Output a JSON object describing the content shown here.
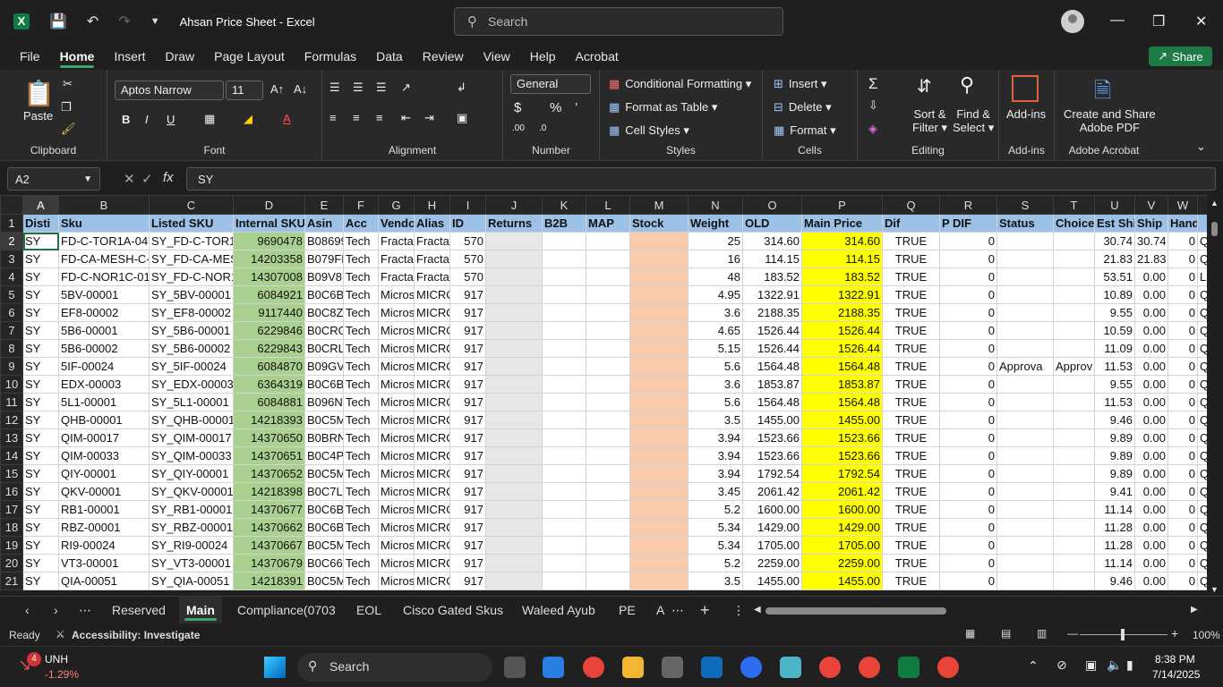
{
  "window": {
    "app_icon": "excel-icon",
    "title": "Ahsan Price Sheet  -  Excel",
    "search_placeholder": "Search"
  },
  "menu": [
    "File",
    "Home",
    "Insert",
    "Draw",
    "Page Layout",
    "Formulas",
    "Data",
    "Review",
    "View",
    "Help",
    "Acrobat"
  ],
  "share_label": "Share",
  "ribbon": {
    "paste": "Paste",
    "clipboard": "Clipboard",
    "font_name": "Aptos Narrow",
    "font_size": "11",
    "font": "Font",
    "alignment": "Alignment",
    "number_format": "General",
    "number": "Number",
    "conditional_formatting": "Conditional Formatting",
    "format_as_table": "Format as Table",
    "cell_styles": "Cell Styles",
    "styles": "Styles",
    "insert": "Insert",
    "delete": "Delete",
    "format": "Format",
    "cells": "Cells",
    "sort_filter_1": "Sort &",
    "sort_filter_2": "Filter",
    "find_select_1": "Find &",
    "find_select_2": "Select",
    "editing": "Editing",
    "addins": "Add-ins",
    "addins_group": "Add-ins",
    "create_share_1": "Create and Share",
    "create_share_2": "Adobe PDF",
    "adobe_acrobat": "Adobe Acrobat"
  },
  "formula_bar": {
    "name_box": "A2",
    "content": "SY"
  },
  "columns": [
    "A",
    "B",
    "C",
    "D",
    "E",
    "F",
    "G",
    "H",
    "I",
    "J",
    "K",
    "L",
    "M",
    "N",
    "O",
    "P",
    "Q",
    "R",
    "S",
    "T",
    "U",
    "V",
    "W",
    "X"
  ],
  "header_row": [
    "Disti",
    "Sku",
    "Listed SKU",
    "Internal SKU",
    "Asin",
    "Acc",
    "Vendor",
    "Alias",
    "ID",
    "Returns",
    "B2B",
    "MAP",
    "Stock",
    "Weight",
    "OLD",
    "Main Price",
    "Dif",
    "P DIF",
    "Status",
    "Choice",
    "Est Ship",
    "Ship",
    "Hand",
    ""
  ],
  "rows": [
    [
      "SY",
      "FD-C-TOR1A-04",
      "SY_FD-C-TOR1A",
      "9690478",
      "B08699",
      "Tech",
      "Fracta",
      "Fracta",
      "570",
      "",
      "",
      "",
      "",
      "25",
      "314.60",
      "314.60",
      "TRUE",
      "0",
      "",
      "",
      "30.74",
      "30.74",
      "0",
      "Q"
    ],
    [
      "SY",
      "FD-CA-MESH-C-E",
      "SY_FD-CA-MESH",
      "14203358",
      "B079FF",
      "Tech",
      "Fracta",
      "Fracta",
      "570",
      "",
      "",
      "",
      "",
      "16",
      "114.15",
      "114.15",
      "TRUE",
      "0",
      "",
      "",
      "21.83",
      "21.83",
      "0",
      "Q"
    ],
    [
      "SY",
      "FD-C-NOR1C-01",
      "SY_FD-C-NOR1C",
      "14307008",
      "B09V87",
      "Tech",
      "Fracta",
      "Fracta",
      "570",
      "",
      "",
      "",
      "",
      "48",
      "183.52",
      "183.52",
      "TRUE",
      "0",
      "",
      "",
      "53.51",
      "0.00",
      "0",
      "L"
    ],
    [
      "SY",
      "5BV-00001",
      "SY_5BV-00001",
      "6084921",
      "B0C6BI",
      "Tech",
      "Micros",
      "MICRO",
      "917",
      "",
      "",
      "",
      "",
      "4.95",
      "1322.91",
      "1322.91",
      "TRUE",
      "0",
      "",
      "",
      "10.89",
      "0.00",
      "0",
      "Q"
    ],
    [
      "SY",
      "EF8-00002",
      "SY_EF8-00002",
      "9117440",
      "B0C8ZC",
      "Tech",
      "Micros",
      "MICRO",
      "917",
      "",
      "",
      "",
      "",
      "3.6",
      "2188.35",
      "2188.35",
      "TRUE",
      "0",
      "",
      "",
      "9.55",
      "0.00",
      "0",
      "Q"
    ],
    [
      "SY",
      "5B6-00001",
      "SY_5B6-00001",
      "6229846",
      "B0CRG",
      "Tech",
      "Micros",
      "MICRO",
      "917",
      "",
      "",
      "",
      "",
      "4.65",
      "1526.44",
      "1526.44",
      "TRUE",
      "0",
      "",
      "",
      "10.59",
      "0.00",
      "0",
      "Q"
    ],
    [
      "SY",
      "5B6-00002",
      "SY_5B6-00002",
      "6229843",
      "B0CRLS",
      "Tech",
      "Micros",
      "MICRO",
      "917",
      "",
      "",
      "",
      "",
      "5.15",
      "1526.44",
      "1526.44",
      "TRUE",
      "0",
      "",
      "",
      "11.09",
      "0.00",
      "0",
      "Q"
    ],
    [
      "SY",
      "5IF-00024",
      "SY_5IF-00024",
      "6084870",
      "B09GVS",
      "Tech",
      "Micros",
      "MICRO",
      "917",
      "",
      "",
      "",
      "",
      "5.6",
      "1564.48",
      "1564.48",
      "TRUE",
      "0",
      "Approva",
      "Approv",
      "11.53",
      "0.00",
      "0",
      "Q"
    ],
    [
      "SY",
      "EDX-00003",
      "SY_EDX-00003",
      "6364319",
      "B0C6BI",
      "Tech",
      "Micros",
      "MICRO",
      "917",
      "",
      "",
      "",
      "",
      "3.6",
      "1853.87",
      "1853.87",
      "TRUE",
      "0",
      "",
      "",
      "9.55",
      "0.00",
      "0",
      "Q"
    ],
    [
      "SY",
      "5L1-00001",
      "SY_5L1-00001",
      "6084881",
      "B096N",
      "Tech",
      "Micros",
      "MICRO",
      "917",
      "",
      "",
      "",
      "",
      "5.6",
      "1564.48",
      "1564.48",
      "TRUE",
      "0",
      "",
      "",
      "11.53",
      "0.00",
      "0",
      "Q"
    ],
    [
      "SY",
      "QHB-00001",
      "SY_QHB-00001",
      "14218393",
      "B0C5M",
      "Tech",
      "Micros",
      "MICRO",
      "917",
      "",
      "",
      "",
      "",
      "3.5",
      "1455.00",
      "1455.00",
      "TRUE",
      "0",
      "",
      "",
      "9.46",
      "0.00",
      "0",
      "Q"
    ],
    [
      "SY",
      "QIM-00017",
      "SY_QIM-00017",
      "14370650",
      "B0BRN",
      "Tech",
      "Micros",
      "MICRO",
      "917",
      "",
      "",
      "",
      "",
      "3.94",
      "1523.66",
      "1523.66",
      "TRUE",
      "0",
      "",
      "",
      "9.89",
      "0.00",
      "0",
      "Q"
    ],
    [
      "SY",
      "QIM-00033",
      "SY_QIM-00033",
      "14370651",
      "B0C4PY",
      "Tech",
      "Micros",
      "MICRO",
      "917",
      "",
      "",
      "",
      "",
      "3.94",
      "1523.66",
      "1523.66",
      "TRUE",
      "0",
      "",
      "",
      "9.89",
      "0.00",
      "0",
      "Q"
    ],
    [
      "SY",
      "QIY-00001",
      "SY_QIY-00001",
      "14370652",
      "B0C5M",
      "Tech",
      "Micros",
      "MICRO",
      "917",
      "",
      "",
      "",
      "",
      "3.94",
      "1792.54",
      "1792.54",
      "TRUE",
      "0",
      "",
      "",
      "9.89",
      "0.00",
      "0",
      "Q"
    ],
    [
      "SY",
      "QKV-00001",
      "SY_QKV-00001",
      "14218398",
      "B0C7LH",
      "Tech",
      "Micros",
      "MICRO",
      "917",
      "",
      "",
      "",
      "",
      "3.45",
      "2061.42",
      "2061.42",
      "TRUE",
      "0",
      "",
      "",
      "9.41",
      "0.00",
      "0",
      "Q"
    ],
    [
      "SY",
      "RB1-00001",
      "SY_RB1-00001",
      "14370677",
      "B0C6B",
      "Tech",
      "Micros",
      "MICRO",
      "917",
      "",
      "",
      "",
      "",
      "5.2",
      "1600.00",
      "1600.00",
      "TRUE",
      "0",
      "",
      "",
      "11.14",
      "0.00",
      "0",
      "Q"
    ],
    [
      "SY",
      "RBZ-00001",
      "SY_RBZ-00001",
      "14370662",
      "B0C6B3",
      "Tech",
      "Micros",
      "MICRO",
      "917",
      "",
      "",
      "",
      "",
      "5.34",
      "1429.00",
      "1429.00",
      "TRUE",
      "0",
      "",
      "",
      "11.28",
      "0.00",
      "0",
      "Q"
    ],
    [
      "SY",
      "RI9-00024",
      "SY_RI9-00024",
      "14370667",
      "B0C5M",
      "Tech",
      "Micros",
      "MICRO",
      "917",
      "",
      "",
      "",
      "",
      "5.34",
      "1705.00",
      "1705.00",
      "TRUE",
      "0",
      "",
      "",
      "11.28",
      "0.00",
      "0",
      "Q"
    ],
    [
      "SY",
      "VT3-00001",
      "SY_VT3-00001",
      "14370679",
      "B0C661",
      "Tech",
      "Micros",
      "MICRO",
      "917",
      "",
      "",
      "",
      "",
      "5.2",
      "2259.00",
      "2259.00",
      "TRUE",
      "0",
      "",
      "",
      "11.14",
      "0.00",
      "0",
      "Q"
    ],
    [
      "SY",
      "QIA-00051",
      "SY_QIA-00051",
      "14218391",
      "B0C5M",
      "Tech",
      "Micros",
      "MICRO",
      "917",
      "",
      "",
      "",
      "",
      "3.5",
      "1455.00",
      "1455.00",
      "TRUE",
      "0",
      "",
      "",
      "9.46",
      "0.00",
      "0",
      "Q"
    ]
  ],
  "sheet_tabs": [
    "Reserved",
    "Main",
    "Compliance(0703",
    "EOL",
    "Cisco Gated Skus",
    "Waleed Ayub",
    "PE",
    "A"
  ],
  "active_tab": "Main",
  "status": {
    "ready": "Ready",
    "accessibility": "Accessibility: Investigate",
    "zoom": "100%"
  },
  "taskbar": {
    "ticker": "UNH",
    "change": "-1.29%",
    "badge": "4",
    "search": "Search",
    "time": "8:38 PM",
    "date": "7/14/2025"
  }
}
